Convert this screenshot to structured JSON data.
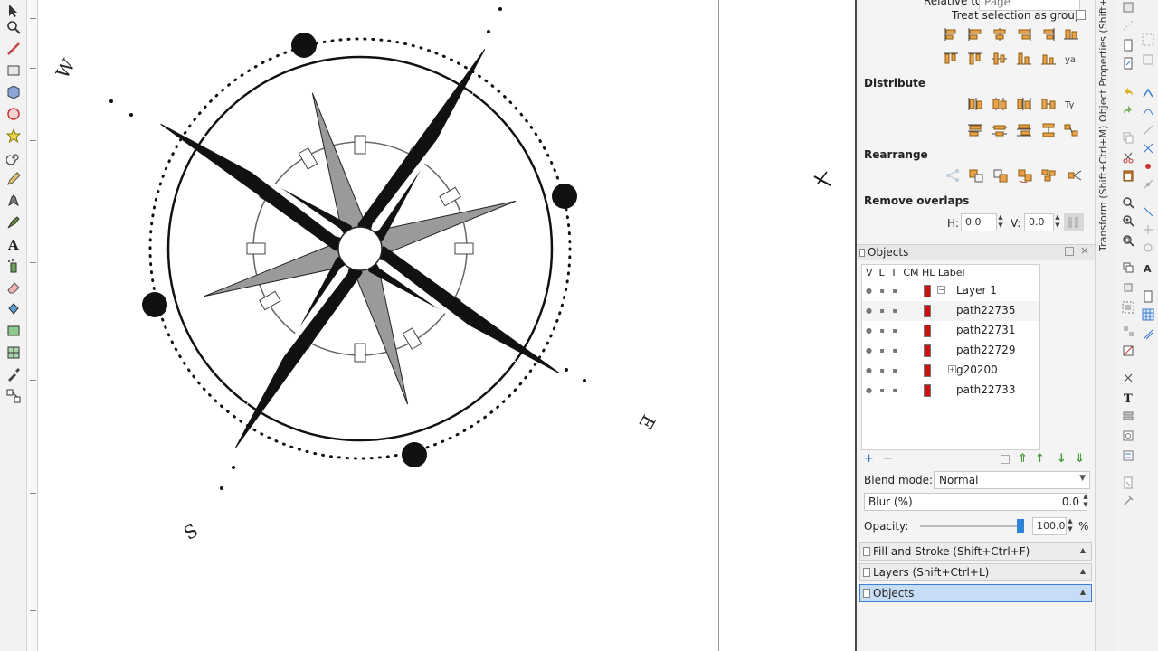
{
  "canvas": {
    "compass_letters": {
      "west": "W",
      "south": "S",
      "east": "E"
    }
  },
  "align": {
    "relative_to_label": "Relative to:",
    "relative_to_value": "Page",
    "treat_selection_label": "Treat selection as group:"
  },
  "distribute": {
    "title": "Distribute"
  },
  "rearrange": {
    "title": "Rearrange"
  },
  "remove_overlaps": {
    "title": "Remove overlaps",
    "h_label": "H:",
    "h_value": "0.0",
    "v_label": "V:",
    "v_value": "0.0"
  },
  "objects_panel": {
    "title": "Objects",
    "columns": "V  L  T  CM HL Label",
    "rows": [
      {
        "label": "Layer 1",
        "kind": "layer"
      },
      {
        "label": "path22735",
        "kind": "path"
      },
      {
        "label": "path22731",
        "kind": "path"
      },
      {
        "label": "path22729",
        "kind": "path"
      },
      {
        "label": "g20200",
        "kind": "group"
      },
      {
        "label": "path22733",
        "kind": "path"
      }
    ],
    "blend_mode_label": "Blend mode:",
    "blend_mode_value": "Normal",
    "blur_label": "Blur (%)",
    "blur_value": "0.0",
    "opacity_label": "Opacity:",
    "opacity_value": "100.0",
    "opacity_unit": "%",
    "opacity_level": 1.0
  },
  "docked_dialogs": [
    {
      "label": "Fill and Stroke (Shift+Ctrl+F)"
    },
    {
      "label": "Layers (Shift+Ctrl+L)"
    },
    {
      "label": "Objects"
    }
  ],
  "vertical_tabs": {
    "object_properties": "Object Properties (Shift+Ctrl+O)",
    "transform": "Transform (Shift+Ctrl+M)"
  },
  "colors": {
    "accent": "#3d7fd4",
    "selected_tab": "#c6ddf5",
    "object_swatch": "#cc1111"
  }
}
